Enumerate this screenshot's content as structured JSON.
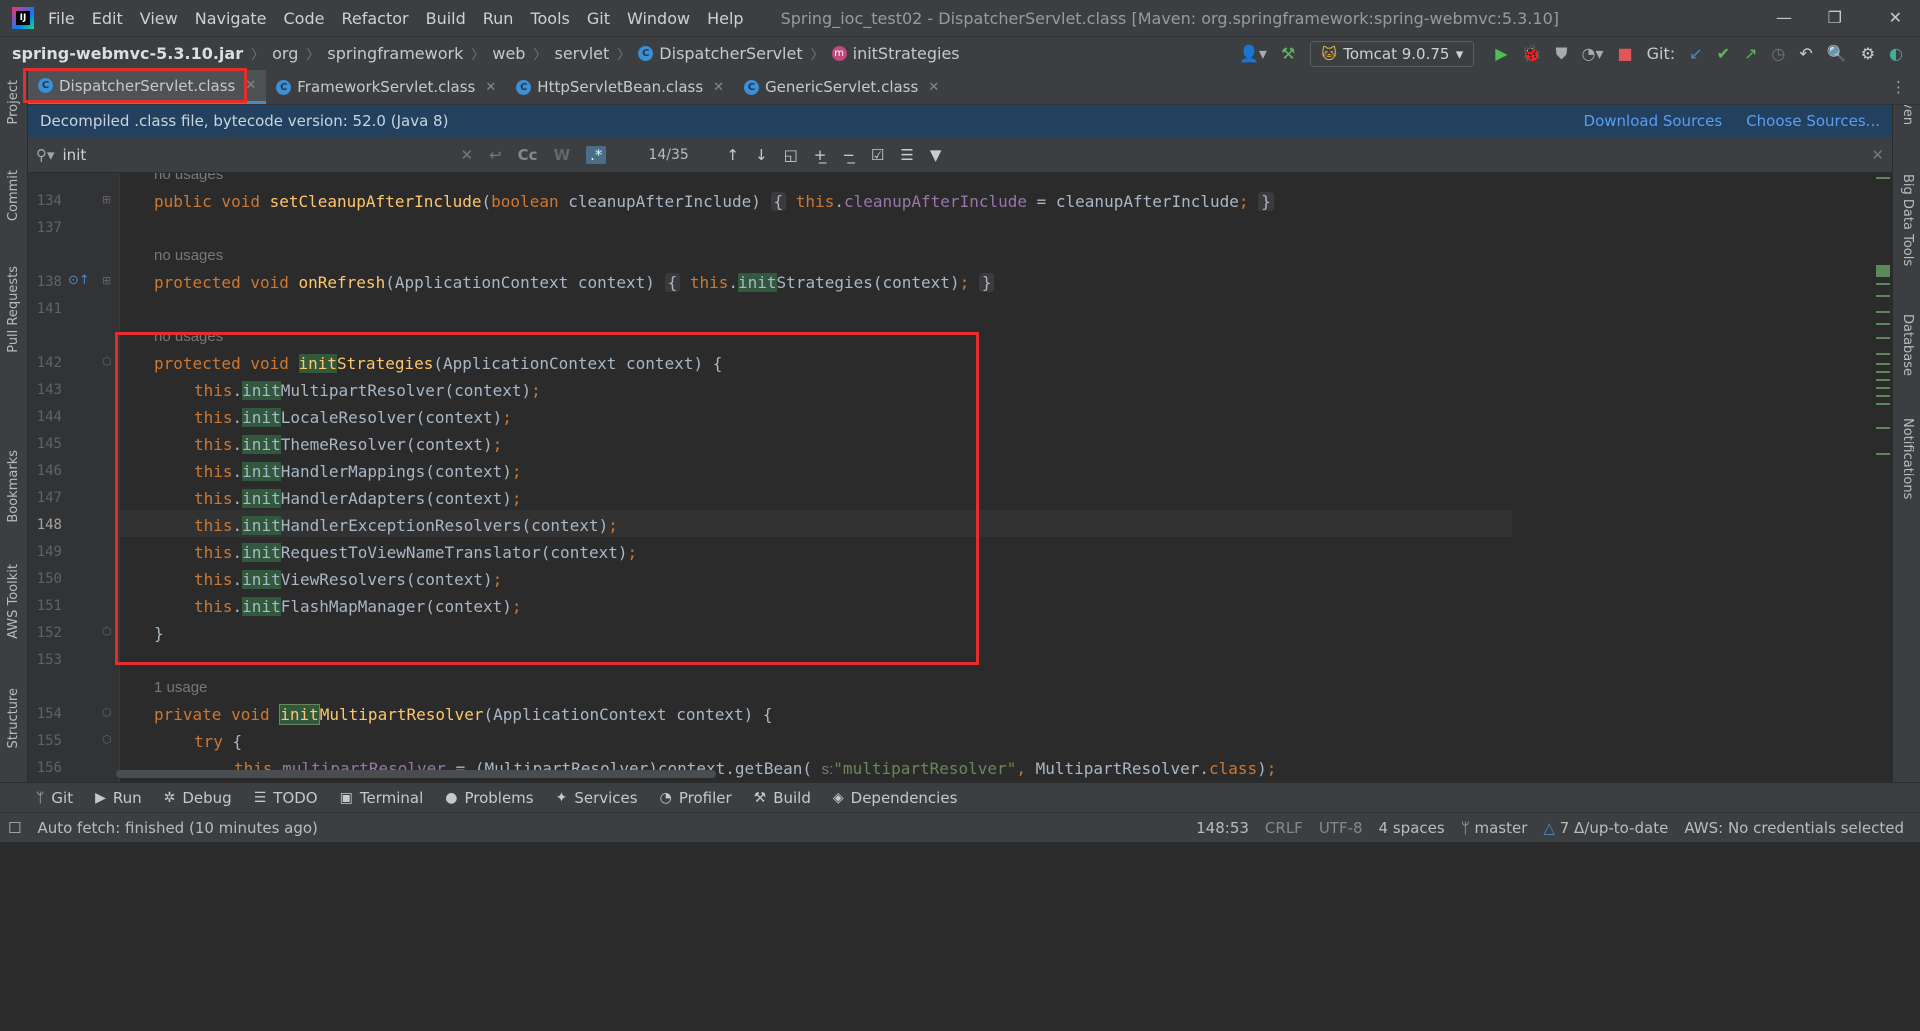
{
  "menubar": {
    "items": [
      "File",
      "Edit",
      "View",
      "Navigate",
      "Code",
      "Refactor",
      "Build",
      "Run",
      "Tools",
      "Git",
      "Window",
      "Help"
    ],
    "window_title": "Spring_ioc_test02 - DispatcherServlet.class [Maven: org.springframework:spring-webmvc:5.3.10]"
  },
  "breadcrumbs": [
    "spring-webmvc-5.3.10.jar",
    "org",
    "springframework",
    "web",
    "servlet",
    "DispatcherServlet",
    "initStrategies"
  ],
  "toolbar": {
    "run_config": "Tomcat 9.0.75",
    "git_label": "Git:"
  },
  "tabs": [
    {
      "label": "DispatcherServlet.class",
      "active": true
    },
    {
      "label": "FrameworkServlet.class",
      "active": false
    },
    {
      "label": "HttpServletBean.class",
      "active": false
    },
    {
      "label": "GenericServlet.class",
      "active": false
    }
  ],
  "infobar": {
    "message": "Decompiled .class file, bytecode version: 52.0 (Java 8)",
    "download_sources": "Download Sources",
    "choose_sources": "Choose Sources..."
  },
  "find": {
    "query": "init",
    "match_count": "14/35",
    "case_label": "Cc",
    "word_label": "W",
    "regex_label": ".*"
  },
  "left_tools": [
    "Project",
    "Commit",
    "Pull Requests",
    "Bookmarks",
    "AWS Toolkit",
    "Structure"
  ],
  "right_tools": [
    "Maven",
    "Big Data Tools",
    "Database",
    "Notifications"
  ],
  "code": {
    "usage_labels": {
      "none": "no usages",
      "one": "1 usage"
    },
    "line_numbers": [
      "134",
      "137",
      "138",
      "141",
      "142",
      "143",
      "144",
      "145",
      "146",
      "147",
      "148",
      "149",
      "150",
      "151",
      "152",
      "153",
      "154",
      "155",
      "156"
    ],
    "lines": [
      {
        "n": "134",
        "text": "public void setCleanupAfterInclude(boolean cleanupAfterInclude) { this.cleanupAfterInclude = cleanupAfterInclude; }"
      },
      {
        "n": "138",
        "text": "protected void onRefresh(ApplicationContext context) { this.initStrategies(context); }"
      },
      {
        "n": "142",
        "text": "protected void initStrategies(ApplicationContext context) {"
      },
      {
        "n": "143",
        "text": "this.initMultipartResolver(context);"
      },
      {
        "n": "144",
        "text": "this.initLocaleResolver(context);"
      },
      {
        "n": "145",
        "text": "this.initThemeResolver(context);"
      },
      {
        "n": "146",
        "text": "this.initHandlerMappings(context);"
      },
      {
        "n": "147",
        "text": "this.initHandlerAdapters(context);"
      },
      {
        "n": "148",
        "text": "this.initHandlerExceptionResolvers(context);"
      },
      {
        "n": "149",
        "text": "this.initRequestToViewNameTranslator(context);"
      },
      {
        "n": "150",
        "text": "this.initViewResolvers(context);"
      },
      {
        "n": "151",
        "text": "this.initFlashMapManager(context);"
      },
      {
        "n": "152",
        "text": "}"
      },
      {
        "n": "154",
        "text": "private void initMultipartResolver(ApplicationContext context) {"
      },
      {
        "n": "155",
        "text": "try {"
      },
      {
        "n": "156",
        "text": "this.multipartResolver = (MultipartResolver)context.getBean(\"multipartResolver\", MultipartResolver.class);"
      }
    ],
    "param_hint": "s:"
  },
  "tool_windows": [
    "Git",
    "Run",
    "Debug",
    "TODO",
    "Terminal",
    "Problems",
    "Services",
    "Profiler",
    "Build",
    "Dependencies"
  ],
  "status": {
    "message": "Auto fetch: finished (10 minutes ago)",
    "position": "148:53",
    "line_sep": "CRLF",
    "encoding": "UTF-8",
    "indent": "4 spaces",
    "branch": "master",
    "sync": "7 Δ/up-to-date",
    "aws": "AWS: No credentials selected"
  },
  "colors": {
    "highlight_box": "#e42e2e",
    "keyword": "#cc7832",
    "method": "#ffc66d",
    "field": "#9876aa",
    "string": "#6a8759",
    "match_bg": "#32593d"
  }
}
